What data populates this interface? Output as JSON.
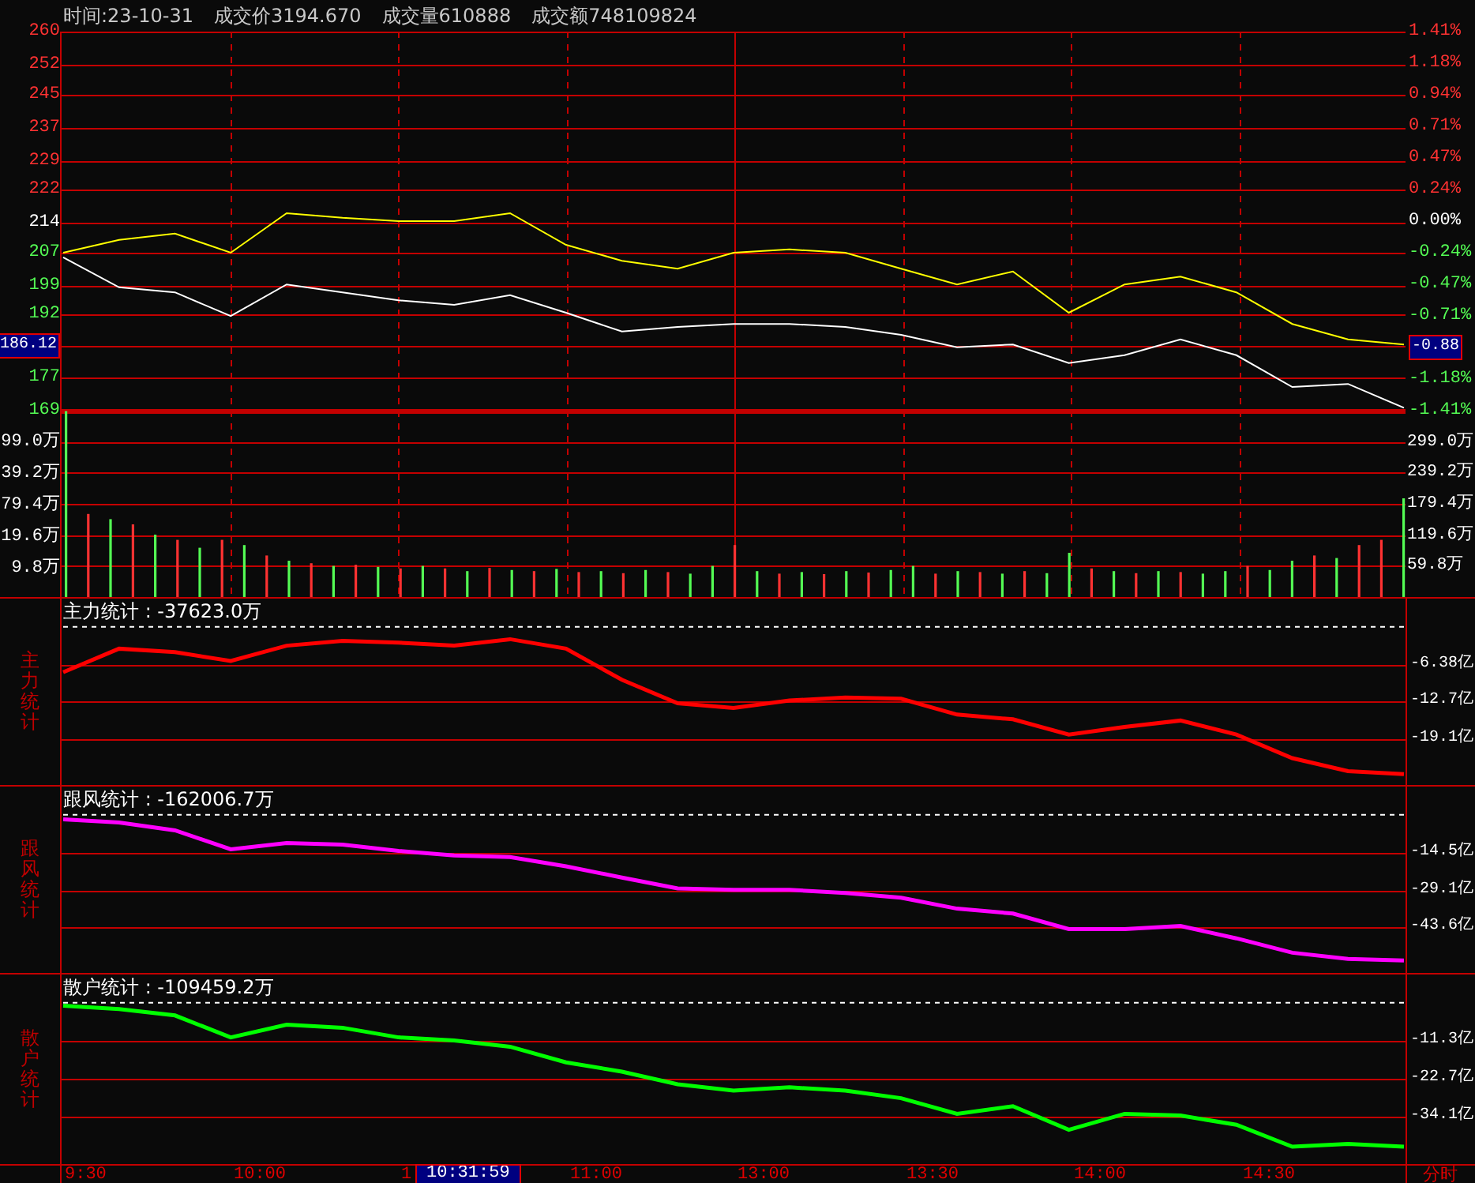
{
  "header": {
    "time": "时间:23-10-31",
    "price": "成交价3194.670",
    "volume": "成交量610888",
    "amount": "成交额748109824"
  },
  "price_panel": {
    "cursor": {
      "label": "186.12"
    },
    "right_axis": [
      {
        "label": "1.41%",
        "color": "#ff3232",
        "highlighted": false
      },
      {
        "label": "1.18%",
        "color": "#ff3232",
        "highlighted": false
      },
      {
        "label": "0.94%",
        "color": "#ff3232",
        "highlighted": false
      },
      {
        "label": "0.71%",
        "color": "#ff3232",
        "highlighted": false
      },
      {
        "label": "0.47%",
        "color": "#ff3232",
        "highlighted": false
      },
      {
        "label": "0.24%",
        "color": "#ff3232",
        "highlighted": false
      },
      {
        "label": "0.00%",
        "color": "#ffffff",
        "highlighted": false
      },
      {
        "label": "-0.24%",
        "color": "#54fc54",
        "highlighted": false
      },
      {
        "label": "-0.47%",
        "color": "#54fc54",
        "highlighted": false
      },
      {
        "label": "-0.71%",
        "color": "#54fc54",
        "highlighted": false
      },
      {
        "label": "-0.88",
        "highlighted": true
      },
      {
        "label": "-1.18%",
        "color": "#54fc54",
        "highlighted": false
      },
      {
        "label": "-1.41%",
        "color": "#54fc54",
        "highlighted": false
      }
    ],
    "chart_data": {
      "type": "line",
      "grid": true,
      "ylim": [
        169,
        260
      ],
      "yticks": [
        {
          "value": 260,
          "label": "260"
        },
        {
          "value": 252,
          "label": "252"
        },
        {
          "value": 245,
          "label": "245"
        },
        {
          "value": 237,
          "label": "237"
        },
        {
          "value": 229,
          "label": "229"
        },
        {
          "value": 222,
          "label": "222"
        },
        {
          "value": 214,
          "label": "214"
        },
        {
          "value": 207,
          "label": "207"
        },
        {
          "value": 199,
          "label": "199"
        },
        {
          "value": 192,
          "label": "192"
        },
        {
          "value": 177,
          "label": "177"
        },
        {
          "value": 169,
          "label": "169"
        }
      ],
      "series": [
        {
          "color": "#ffffff",
          "values": [
            205.8,
            198.6,
            197.4,
            191.7,
            199.3,
            197.4,
            195.5,
            194.4,
            196.7,
            192.5,
            188.0,
            189.1,
            189.8,
            189.8,
            189.1,
            187.2,
            184.2,
            184.9,
            180.4,
            182.3,
            186.1,
            182.3,
            174.7,
            175.4,
            169.7
          ]
        },
        {
          "color": "#ffff00",
          "values": [
            206.9,
            210.0,
            211.5,
            206.9,
            216.4,
            215.3,
            214.5,
            214.5,
            216.4,
            208.8,
            205.0,
            203.1,
            206.9,
            207.7,
            206.9,
            203.1,
            199.3,
            202.4,
            192.5,
            199.3,
            201.2,
            197.4,
            189.8,
            186.1,
            184.9
          ]
        }
      ]
    }
  },
  "volume_panel": {
    "left_axis": [
      "99.0万",
      "39.2万",
      "79.4万",
      "19.6万",
      "9.8万"
    ],
    "chart_data": {
      "type": "bar",
      "stacked": true,
      "grid": true,
      "ylim": [
        0,
        358.8
      ],
      "yticks": [
        {
          "value": 299,
          "label": "299.0万"
        },
        {
          "value": 239.2,
          "label": "239.2万"
        },
        {
          "value": 179.4,
          "label": "179.4万"
        },
        {
          "value": 119.6,
          "label": "119.6万"
        },
        {
          "value": 59.8,
          "label": "59.8万"
        }
      ],
      "series": [
        {
          "color": "#ff3232",
          "values": [
            null,
            160,
            null,
            140,
            null,
            110,
            null,
            110,
            null,
            80,
            null,
            65,
            null,
            62,
            null,
            55,
            null,
            55,
            null,
            56,
            null,
            50,
            null,
            48,
            null,
            46,
            null,
            48,
            null,
            null,
            100,
            null,
            45,
            null,
            44,
            null,
            47,
            null,
            null,
            45,
            null,
            48,
            null,
            50,
            null,
            null,
            55,
            null,
            46,
            null,
            48,
            null,
            null,
            60,
            null,
            null,
            80,
            null,
            100,
            110,
            null
          ]
        },
        {
          "color": "#54fc54",
          "values": [
            358,
            null,
            150,
            null,
            120,
            null,
            95,
            null,
            100,
            null,
            70,
            null,
            60,
            null,
            58,
            null,
            60,
            null,
            50,
            null,
            52,
            null,
            54,
            null,
            50,
            null,
            52,
            null,
            45,
            60,
            null,
            50,
            null,
            48,
            null,
            50,
            null,
            52,
            60,
            null,
            50,
            null,
            45,
            null,
            46,
            85,
            null,
            50,
            null,
            50,
            null,
            45,
            50,
            null,
            52,
            70,
            null,
            75,
            null,
            null,
            190
          ]
        }
      ]
    }
  },
  "indicators": [
    {
      "side_label": "主力统计",
      "title": "主力统计 : -37623.0万",
      "chart_data": {
        "type": "line",
        "grid": true,
        "ylim": [
          -26.85,
          4.79
        ],
        "yticks": [
          {
            "value": -6.38,
            "label": "-6.38亿"
          },
          {
            "value": -12.7,
            "label": "-12.7亿"
          },
          {
            "value": -19.1,
            "label": "-19.1亿"
          }
        ],
        "series": [
          {
            "color": "#ff0000",
            "values": [
              -7.7,
              -3.7,
              -4.3,
              -5.8,
              -3.2,
              -2.4,
              -2.7,
              -3.2,
              -2.1,
              -3.7,
              -9.0,
              -13.0,
              -13.8,
              -12.5,
              -12.0,
              -12.2,
              -14.9,
              -15.7,
              -18.3,
              -17.0,
              -15.9,
              -18.3,
              -22.3,
              -24.5,
              -25.0
            ]
          },
          {
            "color": "#ffffff",
            "line_style": "dashed",
            "values": [
              0,
              0,
              0,
              0,
              0,
              0,
              0,
              0,
              0,
              0,
              0,
              0,
              0,
              0,
              0,
              0,
              0,
              0,
              0,
              0,
              0,
              0,
              0,
              0,
              0
            ]
          }
        ]
      }
    },
    {
      "side_label": "跟风统计",
      "title": "跟风统计 : -162006.7万",
      "chart_data": {
        "type": "line",
        "grid": true,
        "ylim": [
          -61.02,
          10.88
        ],
        "yticks": [
          {
            "value": -14.5,
            "label": "-14.5亿"
          },
          {
            "value": -29.1,
            "label": "-29.1亿"
          },
          {
            "value": -43.6,
            "label": "-43.6亿"
          }
        ],
        "series": [
          {
            "color": "#ff00ff",
            "values": [
              -1.8,
              -3.0,
              -6.0,
              -13.3,
              -10.9,
              -11.5,
              -13.9,
              -15.7,
              -16.3,
              -19.9,
              -24.2,
              -28.4,
              -29.0,
              -29.0,
              -30.2,
              -32.0,
              -36.2,
              -38.1,
              -44.1,
              -44.1,
              -42.9,
              -47.7,
              -53.2,
              -55.6,
              -56.2
            ]
          },
          {
            "color": "#ffffff",
            "line_style": "dashed",
            "values": [
              0,
              0,
              0,
              0,
              0,
              0,
              0,
              0,
              0,
              0,
              0,
              0,
              0,
              0,
              0,
              0,
              0,
              0,
              0,
              0,
              0,
              0,
              0,
              0,
              0
            ]
          }
        ]
      }
    },
    {
      "side_label": "散户统计",
      "title": "散户统计 : -109459.2万",
      "chart_data": {
        "type": "line",
        "grid": true,
        "ylim": [
          -48.5,
          8.48
        ],
        "yticks": [
          {
            "value": -11.3,
            "label": "-11.3亿"
          },
          {
            "value": -22.7,
            "label": "-22.7亿"
          },
          {
            "value": -34.1,
            "label": "-34.1亿"
          }
        ],
        "series": [
          {
            "color": "#00ff00",
            "values": [
              -0.9,
              -1.9,
              -3.8,
              -10.4,
              -6.6,
              -7.5,
              -10.4,
              -11.3,
              -13.2,
              -17.9,
              -20.7,
              -24.5,
              -26.4,
              -25.4,
              -26.4,
              -28.7,
              -33.4,
              -31.1,
              -38.2,
              -33.4,
              -33.9,
              -36.7,
              -43.3,
              -42.4,
              -43.3
            ]
          },
          {
            "color": "#ffffff",
            "line_style": "dashed",
            "values": [
              0,
              0,
              0,
              0,
              0,
              0,
              0,
              0,
              0,
              0,
              0,
              0,
              0,
              0,
              0,
              0,
              0,
              0,
              0,
              0,
              0,
              0,
              0,
              0,
              0
            ]
          }
        ]
      }
    }
  ],
  "time_axis": {
    "ticks": [
      "9:30",
      "10:00",
      "1",
      "11:00",
      "13:00",
      "13:30",
      "14:00",
      "14:30"
    ],
    "cursor": "10:31:59",
    "mode": "分时"
  }
}
